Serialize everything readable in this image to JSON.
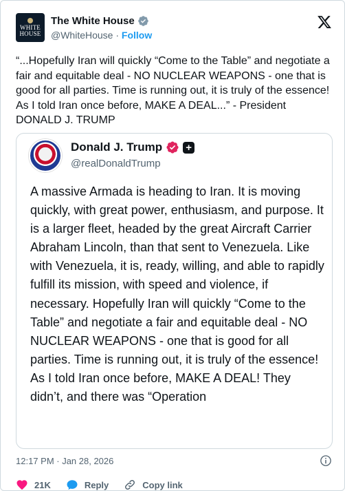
{
  "author": {
    "display_name": "The White House",
    "handle": "@WhiteHouse",
    "separator": " · ",
    "follow_label": "Follow",
    "avatar_text_line1": "WHITE",
    "avatar_text_line2": "HOUSE"
  },
  "tweet": {
    "text": "“...Hopefully Iran will quickly “Come to the Table” and negotiate a fair and equitable deal - NO NUCLEAR WEAPONS - one that is good for all parties. Time is running out, it is truly of the essence! As I told Iran once before, MAKE A DEAL...” - President DONALD J. TRUMP"
  },
  "quoted": {
    "display_name": "Donald J. Trump",
    "handle": "@realDonaldTrump",
    "plus_badge": "+",
    "text": "A massive Armada is heading to Iran. It is moving quickly, with great power, enthusiasm, and purpose. It is a larger fleet, headed by the great Aircraft Carrier Abraham Lincoln, than that sent to Venezuela. Like with Venezuela, it is, ready, willing, and able to rapidly fulfill its mission, with speed and violence, if necessary. Hopefully Iran will quickly “Come to the Table” and negotiate a fair and equitable deal - NO NUCLEAR WEAPONS - one that is good for all parties. Time is running out, it is truly of the essence! As I told Iran once before, MAKE A DEAL! They didn’t, and there was “Operation"
  },
  "meta": {
    "timestamp": "12:17 PM · Jan 28, 2026"
  },
  "actions": {
    "likes": "21K",
    "reply_label": "Reply",
    "copy_link_label": "Copy link"
  },
  "colors": {
    "link_blue": "#1d9bf0",
    "like_pink": "#f91880",
    "verified_gray": "#829aab",
    "verified_pink": "#e0245e",
    "secondary_text": "#536471",
    "border": "#cfd9de"
  },
  "icons": [
    "verified-badge-icon",
    "x-logo-icon",
    "plus-badge-icon",
    "info-icon",
    "heart-icon",
    "reply-bubble-icon",
    "link-icon"
  ]
}
